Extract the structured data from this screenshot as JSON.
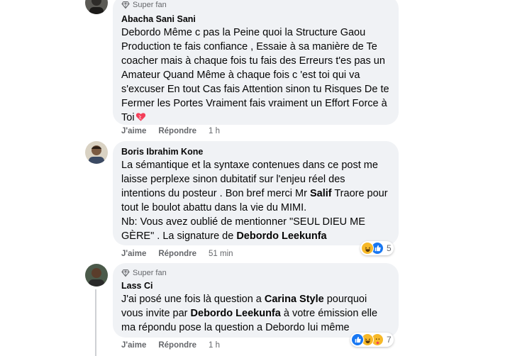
{
  "comments": [
    {
      "badge": "Super fan",
      "author": "Abacha Sani Sani",
      "text": "Debordo Même c pas la Peine quoi la Structure Gaou Production te fais confiance , Essaie à sa manière de Te coacher mais à chaque fois tu fais des Erreurs t'es pas un Amateur Quand Même à chaque fois c 'est toi qui va s'excuser En tout Cas fais Attention sinon tu Risques De te Fermer les Portes Vraiment fais vraiment un Effort Force à Toi",
      "like": "J'aime",
      "reply": "Répondre",
      "time": "1 h"
    },
    {
      "author": "Boris Ibrahim Kone",
      "text_p1": "La sémantique et la syntaxe contenues dans ce post me laisse perplexe sinon dubitatif sur l'enjeu réel des intentions du posteur . Bon bref merci Mr ",
      "bold1": "Salif",
      "text_p2": " Traore pour tout le boulot abattu dans la vie du MIMI.",
      "text_p3": "Nb: Vous avez oublié de mentionner \"SEUL DIEU ME GÈRE\" . La signature de ",
      "bold2": "Debordo Leekunfa",
      "like": "J'aime",
      "reply": "Répondre",
      "time": "51 min",
      "reaction_count": "5"
    },
    {
      "badge": "Super fan",
      "author": "Lass Ci",
      "text_p1": "J'ai posé une fois là question a ",
      "bold1": "Carina Style",
      "text_p2": " pourquoi vous invite par ",
      "bold2": "Debordo Leekunfa",
      "text_p3": " à votre émission elle ma répondu pose la question a Debordo lui même",
      "like": "J'aime",
      "reply": "Répondre",
      "time": "1 h",
      "reaction_count": "7"
    }
  ],
  "colors": {
    "bubble": "#f0f2f5",
    "meta_text": "#65676b",
    "like_blue": "#1877f2",
    "haha_yellow": "#f7b928"
  }
}
